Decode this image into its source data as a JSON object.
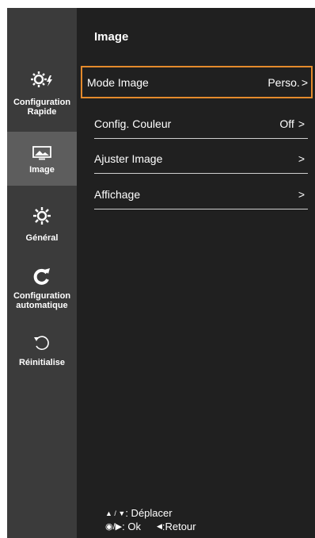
{
  "sidebar": {
    "items": [
      {
        "label": "Configuration\nRapide",
        "icon": "quick-settings-icon"
      },
      {
        "label": "Image",
        "icon": "picture-icon",
        "active": true
      },
      {
        "label": "Général",
        "icon": "gear-icon"
      },
      {
        "label": "Configuration\nautomatique",
        "icon": "auto-config-icon"
      },
      {
        "label": "Réinitialise",
        "icon": "reset-icon"
      }
    ]
  },
  "main": {
    "title": "Image",
    "menu": [
      {
        "label": "Mode Image",
        "value": "Perso."
      },
      {
        "label": "Config. Couleur",
        "value": "Off"
      },
      {
        "label": "Ajuster Image",
        "value": ""
      },
      {
        "label": "Affichage",
        "value": ""
      }
    ]
  },
  "footer": {
    "move_label": ": Déplacer",
    "ok_label": ": Ok",
    "back_label": ":Retour"
  },
  "colors": {
    "accent": "#e48a2c",
    "panel": "#202020",
    "sidebar": "#3b3b3b",
    "sidebar_active": "#5d5d5d"
  }
}
